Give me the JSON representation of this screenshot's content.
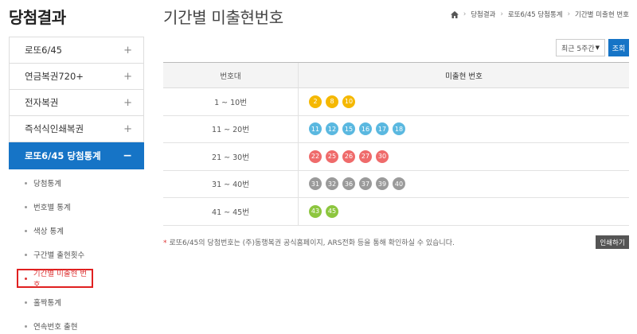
{
  "sidebar": {
    "title": "당첨결과",
    "menu": [
      {
        "label": "로또6/45",
        "toggle": "+"
      },
      {
        "label": "연금복권720+",
        "toggle": "+"
      },
      {
        "label": "전자복권",
        "toggle": "+"
      },
      {
        "label": "즉석식인쇄복권",
        "toggle": "+"
      },
      {
        "label": "로또6/45 당첨통계",
        "toggle": "−"
      }
    ],
    "submenu": [
      {
        "label": "당첨통계"
      },
      {
        "label": "번호별 통계"
      },
      {
        "label": "색상 통계"
      },
      {
        "label": "구간별 출현횟수"
      },
      {
        "label": "기간별 미출현 번호"
      },
      {
        "label": "홀짝통계"
      },
      {
        "label": "연속번호 출현"
      }
    ]
  },
  "main": {
    "title": "기간별 미출현번호",
    "breadcrumb": [
      "당첨결과",
      "로또6/45 당첨통계",
      "기간별 미출현 번호"
    ],
    "period_select": "최근 5주간",
    "query_label": "조회",
    "table": {
      "headers": [
        "번호대",
        "미출현 번호"
      ],
      "rows": [
        {
          "range": "1 ~ 10번",
          "numbers": [
            "2",
            "8",
            "10"
          ],
          "color": "#f5b800"
        },
        {
          "range": "11 ~ 20번",
          "numbers": [
            "11",
            "12",
            "15",
            "16",
            "17",
            "18"
          ],
          "color": "#5ab8e0"
        },
        {
          "range": "21 ~ 30번",
          "numbers": [
            "22",
            "25",
            "26",
            "27",
            "30"
          ],
          "color": "#ef6b6b"
        },
        {
          "range": "31 ~ 40번",
          "numbers": [
            "31",
            "32",
            "36",
            "37",
            "39",
            "40"
          ],
          "color": "#9a9a9a"
        },
        {
          "range": "41 ~ 45번",
          "numbers": [
            "43",
            "45"
          ],
          "color": "#8dc63f"
        }
      ]
    },
    "note": "로또6/45의 당첨번호는 (주)동행복권 공식홈페이지, ARS전화 등을 통해 확인하실 수 있습니다.",
    "print_label": "인쇄하기"
  }
}
